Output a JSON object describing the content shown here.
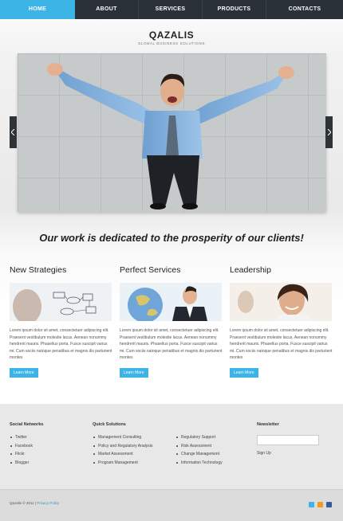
{
  "nav": {
    "items": [
      {
        "label": "HOME"
      },
      {
        "label": "ABOUT"
      },
      {
        "label": "SERVICES"
      },
      {
        "label": "PRODUCTS"
      },
      {
        "label": "CONTACTS"
      }
    ],
    "active_color": "#3cb4e6",
    "bg_color": "#2b3138"
  },
  "header": {
    "logo": "QAZALIS",
    "tagline": "GLOBAL BUSINESS SOLUTIONS"
  },
  "slider": {
    "prev_icon": "chevron-left-icon",
    "next_icon": "chevron-right-icon"
  },
  "headline": "Our work is dedicated to the prosperity of our clients!",
  "columns": [
    {
      "title": "New Strategies",
      "text": "Lorem ipsum dolor sit amet, consectetuer adipiscing elit. Praesent vestibulum molestie lacus. Aenean nonummy hendrerit mauris. Phasellus porta. Fusce suscipit varius mi. Cum sociis natoque penatibus et magnis dis parturient montes",
      "button": "Learn More"
    },
    {
      "title": "Perfect Services",
      "text": "Lorem ipsum dolor sit amet, consectetuer adipiscing elit. Praesent vestibulum molestie lacus. Aenean nonummy hendrerit mauris. Phasellus porta. Fusce suscipit varius mi. Cum sociis natoque penatibus et magnis dis parturient montes",
      "button": "Learn More"
    },
    {
      "title": "Leadership",
      "text": "Lorem ipsum dolor sit amet, consectetuer adipiscing elit. Praesent vestibulum molestie lacus. Aenean nonummy hendrerit mauris. Phasellus porta. Fusce suscipit varius mi. Cum sociis natoque penatibus et magnis dis parturient montes",
      "button": "Learn More"
    }
  ],
  "footer": {
    "social_title": "Social Networks",
    "social": [
      "Twitter",
      "Facebook",
      "Flickr",
      "Blogger"
    ],
    "quick_title": "Quick Solutions",
    "quick_col1": [
      "Management Consulting",
      "Policy and Regulatory Analysis",
      "Market Assessment",
      "Program Management"
    ],
    "quick_col2": [
      "Regulatory Support",
      "Risk Assessment",
      "Change Management",
      "Information Technology"
    ],
    "newsletter_title": "Newsletter",
    "newsletter_value": "",
    "signup": "Sign Up",
    "copyright": "Qazalis © 2011",
    "privacy": "Privacy Policy",
    "social_icons": [
      "twitter-icon",
      "rss-icon",
      "facebook-icon"
    ]
  }
}
